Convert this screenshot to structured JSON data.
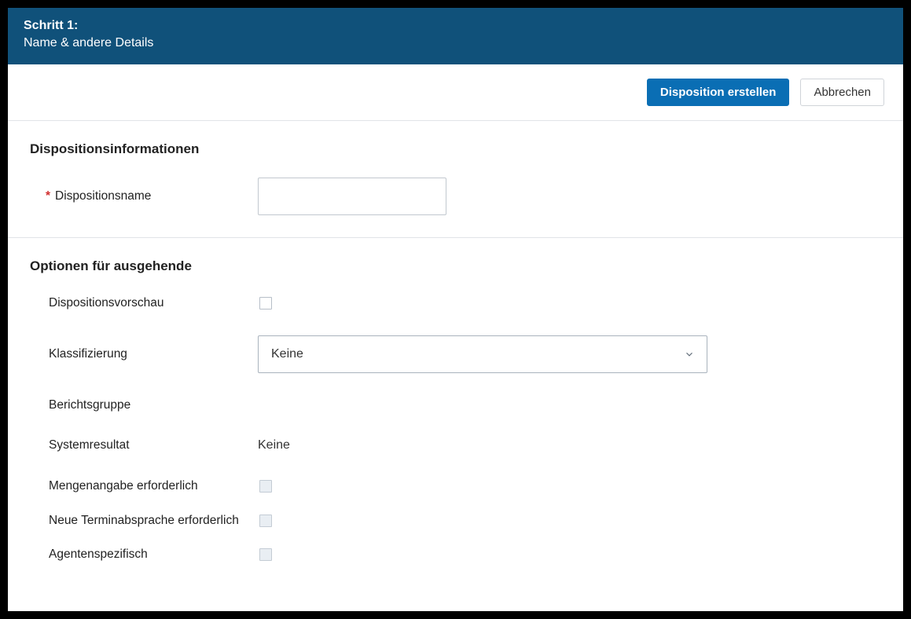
{
  "header": {
    "step_label": "Schritt 1:",
    "subtitle": "Name & andere Details"
  },
  "actions": {
    "create_label": "Disposition erstellen",
    "cancel_label": "Abbrechen"
  },
  "section_info": {
    "title": "Dispositionsinformationen",
    "name_label": "Dispositionsname",
    "name_value": ""
  },
  "section_outbound": {
    "title": "Optionen für ausgehende",
    "preview_label": "Dispositionsvorschau",
    "classification_label": "Klassifizierung",
    "classification_value": "Keine",
    "reportgroup_label": "Berichtsgruppe",
    "systemresult_label": "Systemresultat",
    "systemresult_value": "Keine",
    "quantity_required_label": "Mengenangabe erforderlich",
    "reschedule_required_label": "Neue Terminabsprache erforderlich",
    "agent_specific_label": "Agentenspezifisch"
  }
}
